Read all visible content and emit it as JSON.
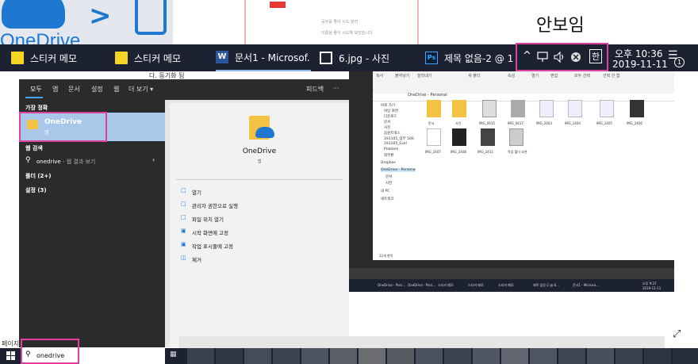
{
  "annotation": {
    "text": "안보임"
  },
  "background": {
    "onedrive_label": "OneDrive",
    "doc_line1": "공부를 좋아 시도 말라",
    "doc_line2": "이름을 좋아 시도해 보았습니다",
    "window_caption": "다. 동기화 됨",
    "status_text": "페이지"
  },
  "taskbar": {
    "apps": [
      {
        "label": "스티커 메모"
      },
      {
        "label": "스티커 메모"
      },
      {
        "label": "문서1 - Microsof..."
      },
      {
        "label": "6.jpg - 사진"
      },
      {
        "label": "제목 없음-2 @ 1..."
      }
    ],
    "tray": {
      "chevron": "^",
      "network_icon": "network-icon",
      "volume_icon": "volume-icon",
      "onedrive_status_icon": "x-circle-icon",
      "ime": "한"
    },
    "clock_time": "오후 10:36",
    "clock_date": "2019-11-11",
    "notification_count": "1"
  },
  "start_search": {
    "tabs": [
      "모두",
      "앱",
      "문서",
      "설정",
      "웹",
      "더 보기 ▾"
    ],
    "feedback": "피드백",
    "more": "···",
    "best_match_header": "가장 정확",
    "best_match": {
      "title": "OneDrive",
      "subtitle": "앱"
    },
    "web_search_header": "웹 검색",
    "web_search": {
      "query": "onedrive",
      "suffix": " - 웹 결과 보기"
    },
    "folders": "폴더 (2+)",
    "settings": "설정 (3)",
    "detail": {
      "title": "OneDrive",
      "subtitle": "앱",
      "actions": [
        "열기",
        "관리자 권한으로 실행",
        "파일 위치 열기",
        "시작 화면에 고정",
        "작업 표시줄에 고정",
        "제거"
      ]
    }
  },
  "search_box": {
    "value": "onedrive"
  },
  "screenshot_preview": {
    "ribbon": [
      "복사",
      "붙여넣기",
      "잘라내기",
      "새 폴더",
      "속성",
      "열기",
      "편집",
      "모두 선택",
      "선택 안 함"
    ],
    "address": "OneDrive - Personal",
    "nav": [
      "바로 가기",
      "바탕 화면",
      "다운로드",
      "문서",
      "사진",
      "음원트랙스",
      "191105_업무 500",
      "191105_Exel",
      "Problem",
      "외부환",
      "Dropbox",
      "OneDrive - Persona",
      "문서",
      "사진",
      "내 PC",
      "네트워크"
    ],
    "items": [
      "문서",
      "사진",
      "IMG_0415",
      "IMG_0417",
      "IMG_2403",
      "IMG_2404",
      "IMG_2405",
      "IMG_2406",
      "IMG_2407",
      "IMG_2408",
      "IMG_2411",
      "작업 폴더 보관"
    ],
    "status": "12개 항목",
    "taskbar_apps": [
      "OneDrive - Pers...",
      "OneDrive - Pers...",
      "스티커 메모",
      "스티커 메모",
      "스티커 메모",
      "제목 없음-2 @ 6...",
      "문서1 - Microso..."
    ],
    "clock": "오후 9:37\n2019-11-11"
  }
}
